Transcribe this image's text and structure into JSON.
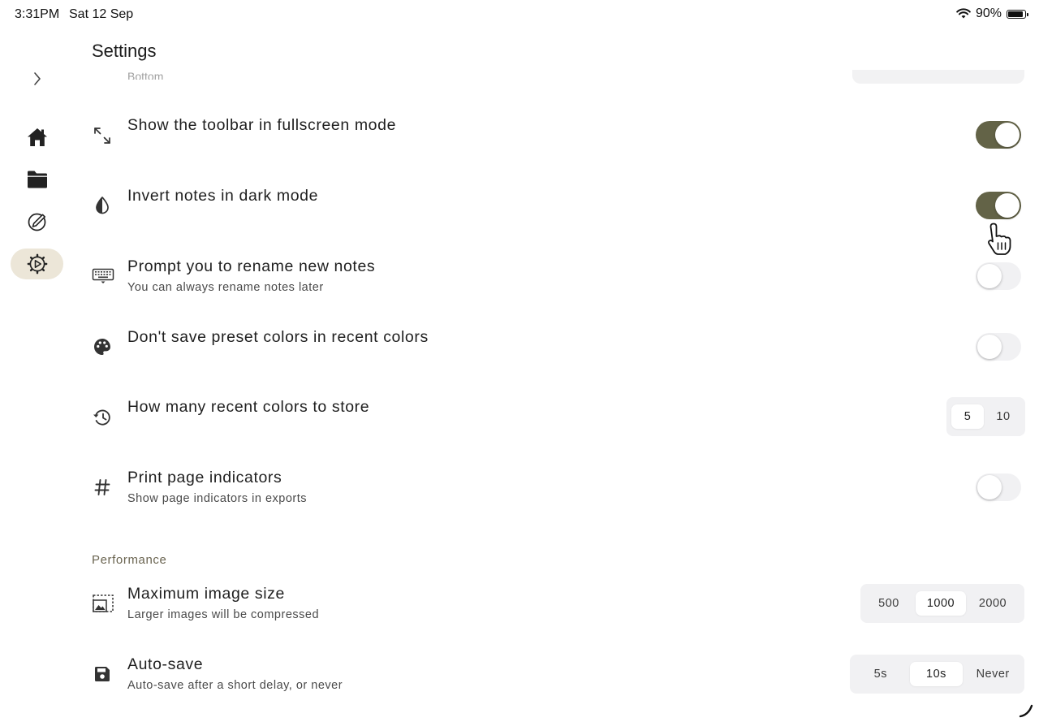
{
  "status_bar": {
    "time": "3:31PM",
    "date": "Sat 12 Sep",
    "battery": "90%"
  },
  "rail": {
    "items": [
      {
        "icon": "chevron-right-icon"
      },
      {
        "icon": "home-icon"
      },
      {
        "icon": "folder-icon"
      },
      {
        "icon": "pen-circle-icon"
      },
      {
        "icon": "settings-gear-icon",
        "active": true
      }
    ]
  },
  "header": {
    "title": "Settings"
  },
  "remnant": {
    "text": "Bottom"
  },
  "rows": {
    "fullscreen_toolbar": {
      "title": "Show the toolbar in fullscreen mode",
      "icon": "expand-arrows-icon",
      "on": true
    },
    "invert_dark": {
      "title": "Invert notes in dark mode",
      "icon": "contrast-drop-icon",
      "on": true
    },
    "rename_prompt": {
      "title": "Prompt you to rename new notes",
      "subtitle": "You can always rename notes later",
      "icon": "keyboard-icon",
      "on": false
    },
    "preset_colors": {
      "title": "Don't save preset colors in recent colors",
      "icon": "palette-icon",
      "on": false
    },
    "recent_colors": {
      "title": "How many recent colors to store",
      "icon": "history-icon",
      "options": [
        "5",
        "10"
      ],
      "selected": "5"
    },
    "page_indicators": {
      "title": "Print page indicators",
      "subtitle": "Show page indicators in exports",
      "icon": "hash-icon",
      "on": false
    },
    "max_image": {
      "title": "Maximum image size",
      "subtitle": "Larger images will be compressed",
      "icon": "image-resize-icon",
      "options": [
        "500",
        "1000",
        "2000"
      ],
      "selected": "1000"
    },
    "autosave": {
      "title": "Auto-save",
      "subtitle": "Auto-save after a short delay, or never",
      "icon": "save-icon",
      "options": [
        "5s",
        "10s",
        "Never"
      ],
      "selected": "10s"
    }
  },
  "sections": {
    "performance": "Performance"
  },
  "colors": {
    "accent": "#636347",
    "active_rail": "#ece6d8",
    "section_label": "#6a6450"
  }
}
